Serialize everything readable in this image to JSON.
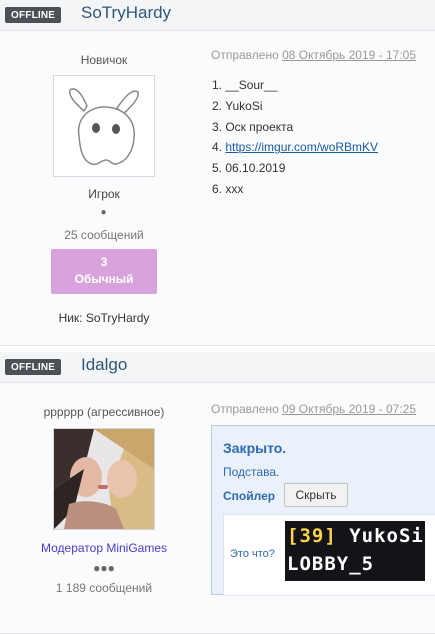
{
  "posts": [
    {
      "status": "OFFLINE",
      "username": "SoTryHardy",
      "rank_title": "Новичок",
      "group": "Игрок",
      "posts_count": "25 сообщений",
      "reputation_value": "3",
      "reputation_label": "Обычный",
      "nick": "Ник: SoTryHardy",
      "date_prefix": "Отправлено",
      "date": "08 Октябрь 2019 - 17:05",
      "lines": [
        "1. __Sour__",
        "2. YukoSi",
        "3. Оск проекта",
        "https://imgur.com/woRBmKV",
        "5. 06.10.2019",
        "6. xxx"
      ],
      "link_prefix": "4. "
    },
    {
      "status": "OFFLINE",
      "username": "Idalgo",
      "rank_title": "pppppp (агрессивное)",
      "group": "Модератор MiniGames",
      "posts_count": "1 189 сообщений",
      "date_prefix": "Отправлено",
      "date": "09 Октябрь 2019 - 07:25",
      "quote": {
        "title": "Закрыто.",
        "text": "Подстава.",
        "spoiler_label": "Спойлер",
        "hide_button": "Скрыть",
        "spoiler_question": "Это что?",
        "image_line1_bracket": "[39]",
        "image_line1_name": " YukoSi",
        "image_line2": "LOBBY_5"
      }
    }
  ],
  "colors": {
    "badge": "#4c5157",
    "username": "#2f5779",
    "reputation": "#d8a3dc",
    "moderator": "#4a3cc8",
    "quote_blue": "#2e6ab2"
  }
}
